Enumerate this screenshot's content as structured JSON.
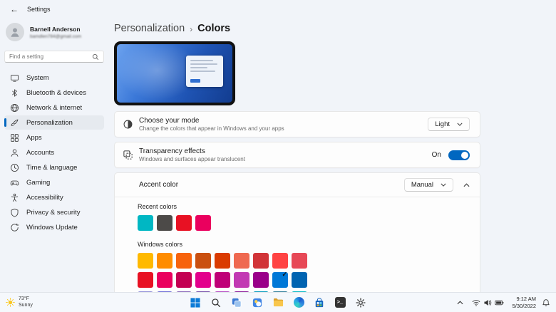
{
  "titlebar": {
    "app_name": "Settings",
    "back_glyph": "←"
  },
  "user": {
    "name": "Barnell Anderson",
    "email_masked": "bamdlen784@gmail.com"
  },
  "search": {
    "placeholder": "Find a setting"
  },
  "sidebar": {
    "items": [
      {
        "label": "System"
      },
      {
        "label": "Bluetooth & devices"
      },
      {
        "label": "Network & internet"
      },
      {
        "label": "Personalization"
      },
      {
        "label": "Apps"
      },
      {
        "label": "Accounts"
      },
      {
        "label": "Time & language"
      },
      {
        "label": "Gaming"
      },
      {
        "label": "Accessibility"
      },
      {
        "label": "Privacy & security"
      },
      {
        "label": "Windows Update"
      }
    ],
    "selected": "Personalization"
  },
  "breadcrumb": {
    "parent": "Personalization",
    "separator": "›",
    "current": "Colors"
  },
  "cards": {
    "mode": {
      "title": "Choose your mode",
      "subtitle": "Change the colors that appear in Windows and your apps",
      "value": "Light"
    },
    "transparency": {
      "title": "Transparency effects",
      "subtitle": "Windows and surfaces appear translucent",
      "state": "On"
    },
    "accent": {
      "title": "Accent color",
      "value": "Manual",
      "recent_label": "Recent colors",
      "recent_colors": [
        "#00B7C3",
        "#4C4A48",
        "#E81123",
        "#EA005E"
      ],
      "windows_label": "Windows colors",
      "windows_colors": [
        "#FFB900",
        "#FF8C00",
        "#F7630C",
        "#CA5010",
        "#DA3B01",
        "#EF6950",
        "#D13438",
        "#FF4343",
        "#E74856",
        "#E81123",
        "#EA005E",
        "#C30052",
        "#E3008C",
        "#BF0077",
        "#C239B3",
        "#9A0089",
        "#0078D7",
        "#0063B1",
        "#8E8CD8",
        "#6B69D6",
        "#8764B8",
        "#744DA9",
        "#B146C2",
        "#881798",
        "#0099BC",
        "#2D7D9A",
        "#00B7C3"
      ],
      "selected_index": 16,
      "selected_color": "#0078D7"
    }
  },
  "accent_color": "#0067C0",
  "taskbar": {
    "weather": {
      "temp": "73°F",
      "condition": "Sunny"
    },
    "center_icons": [
      "start",
      "search",
      "task-view",
      "widgets",
      "file-explorer",
      "edge",
      "store",
      "terminal",
      "settings"
    ],
    "tray_icons": [
      "chevron-up",
      "wifi",
      "volume",
      "battery"
    ],
    "clock": {
      "time": "9:12 AM",
      "date": "5/30/2022"
    }
  }
}
